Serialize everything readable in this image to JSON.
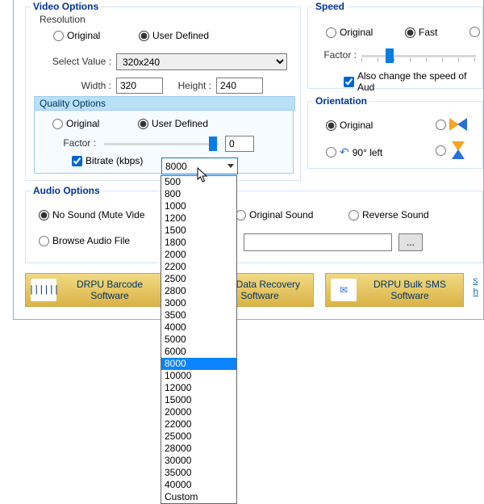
{
  "video": {
    "legend": "Video Options",
    "resolution": {
      "label": "Resolution",
      "original": "Original",
      "user_defined": "User Defined",
      "select_value_label": "Select Value :",
      "select_value": "320x240",
      "width_label": "Width :",
      "width": "320",
      "height_label": "Height :",
      "height": "240"
    },
    "quality": {
      "legend": "Quality Options",
      "original": "Original",
      "user_defined": "User Defined",
      "factor_label": "Factor :",
      "factor_value": "0",
      "bitrate_label": "Bitrate (kbps)",
      "bitrate_value": "8000",
      "bitrate_options": [
        "500",
        "800",
        "1000",
        "1200",
        "1500",
        "1800",
        "2000",
        "2200",
        "2500",
        "2800",
        "3000",
        "3500",
        "4000",
        "5000",
        "6000",
        "8000",
        "10000",
        "12000",
        "15000",
        "20000",
        "22000",
        "25000",
        "28000",
        "30000",
        "35000",
        "40000",
        "Custom"
      ]
    }
  },
  "speed": {
    "legend": "Speed",
    "original": "Original",
    "fast": "Fast",
    "factor_label": "Factor :",
    "also_change": "Also change the speed of Aud"
  },
  "orientation": {
    "legend": "Orientation",
    "original": "Original",
    "ninety_left": "90° left"
  },
  "audio": {
    "legend": "Audio Options",
    "no_sound": "No Sound (Mute Vide",
    "original_sound": "Original Sound",
    "reverse_sound": "Reverse Sound",
    "browse": "Browse Audio File",
    "browse_btn": "..."
  },
  "footer": {
    "barcode": "DRPU Barcode Software",
    "recovery": "DR Data Recovery Software",
    "sms": "DRPU Bulk SMS Software"
  },
  "side": {
    "a": "s",
    "b": "h"
  }
}
